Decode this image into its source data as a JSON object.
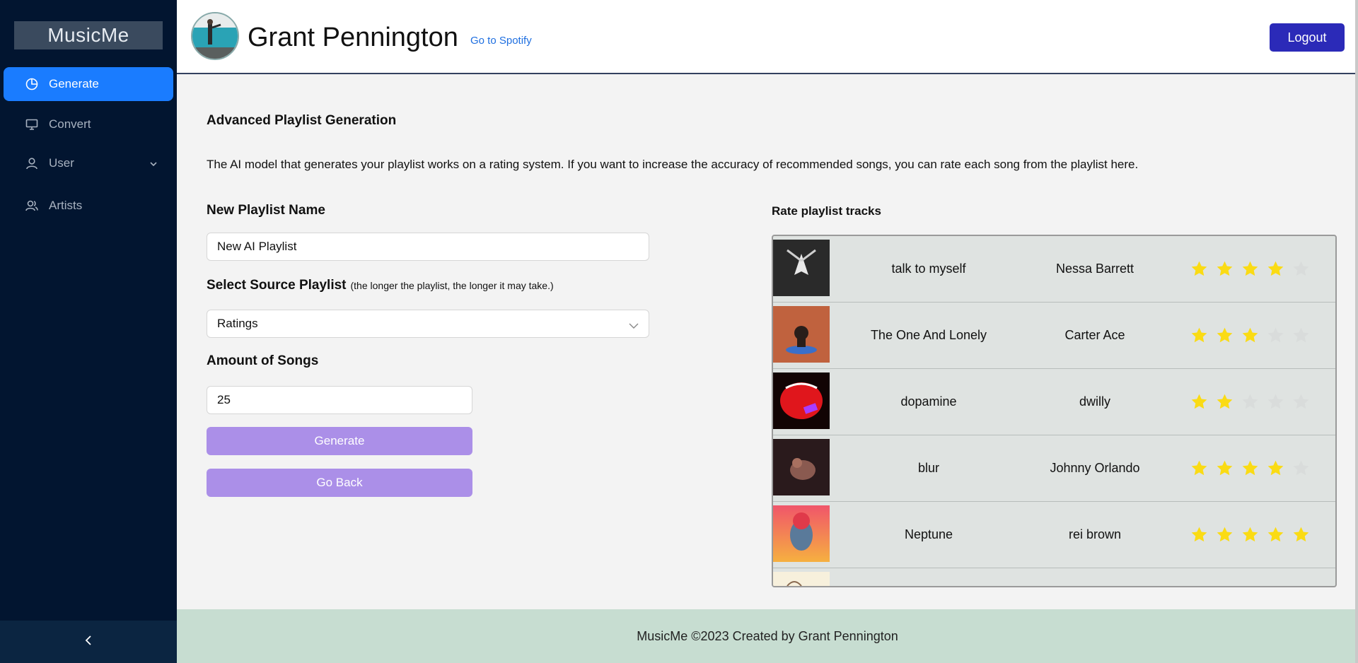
{
  "sidebar": {
    "logo": "MusicMe",
    "items": [
      {
        "label": "Generate",
        "icon": "pie-chart-icon",
        "active": true
      },
      {
        "label": "Convert",
        "icon": "monitor-icon"
      },
      {
        "label": "User",
        "icon": "user-icon"
      },
      {
        "label": "Artists",
        "icon": "team-icon"
      }
    ],
    "collapse_icon": "chevron-left-icon"
  },
  "header": {
    "user_name": "Grant Pennington",
    "spotify_link": "Go to Spotify",
    "logout_label": "Logout"
  },
  "main": {
    "title": "Advanced Playlist Generation",
    "description": "The AI model that generates your playlist works on a rating system. If you want to increase the accuracy of recommended songs, you can rate each song from the playlist here.",
    "playlist_name_label": "New Playlist Name",
    "playlist_name_value": "New AI Playlist",
    "source_label": "Select Source Playlist",
    "source_hint": "(the longer the playlist, the longer it may take.)",
    "source_value": "Ratings",
    "amount_label": "Amount of Songs",
    "amount_value": "25",
    "generate_label": "Generate",
    "back_label": "Go Back"
  },
  "tracks_panel": {
    "title": "Rate playlist tracks",
    "tracks": [
      {
        "name": "talk to myself",
        "artist": "Nessa Barrett",
        "rating": 4
      },
      {
        "name": "The One And Lonely",
        "artist": "Carter Ace",
        "rating": 3
      },
      {
        "name": "dopamine",
        "artist": "dwilly",
        "rating": 2
      },
      {
        "name": "blur",
        "artist": "Johnny Orlando",
        "rating": 4
      },
      {
        "name": "Neptune",
        "artist": "rei brown",
        "rating": 5
      }
    ]
  },
  "footer": {
    "text": "MusicMe ©2023 Created by Grant Pennington"
  },
  "colors": {
    "sidebar_bg": "#021530",
    "active_nav": "#1a7cff",
    "logout_bg": "#2b2ab8",
    "button_bg": "#ab8fe8",
    "star_on": "#fadb14",
    "star_off": "#d9dcdb",
    "footer_bg": "#c7ddd1"
  }
}
